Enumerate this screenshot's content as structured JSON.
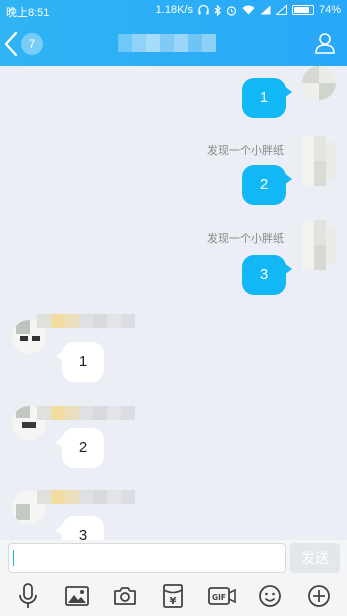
{
  "status_bar": {
    "time": "晚上8:51",
    "network_speed": "1.18K/s",
    "battery": "74%"
  },
  "header": {
    "unread_count": "7",
    "contact_name": ""
  },
  "messages": [
    {
      "direction": "out",
      "text": "1",
      "sender_nick": ""
    },
    {
      "direction": "out",
      "text": "2",
      "sender_nick": "发现一个小胖纸"
    },
    {
      "direction": "out",
      "text": "3",
      "sender_nick": "发现一个小胖纸"
    },
    {
      "direction": "in",
      "text": "1"
    },
    {
      "direction": "in",
      "text": "2"
    },
    {
      "direction": "in",
      "text": "3"
    }
  ],
  "input": {
    "value": "",
    "placeholder": "",
    "send_label": "发送"
  },
  "toolbar": {
    "items": [
      "microphone-icon",
      "image-icon",
      "camera-icon",
      "red-packet-icon",
      "gif-icon",
      "emoji-icon",
      "plus-icon"
    ],
    "gif_label": "GIF",
    "yen_label": "¥"
  },
  "colors": {
    "header_blue": "#28a8f8",
    "bubble_blue": "#12b7f5",
    "chat_bg": "#ebeef5"
  }
}
